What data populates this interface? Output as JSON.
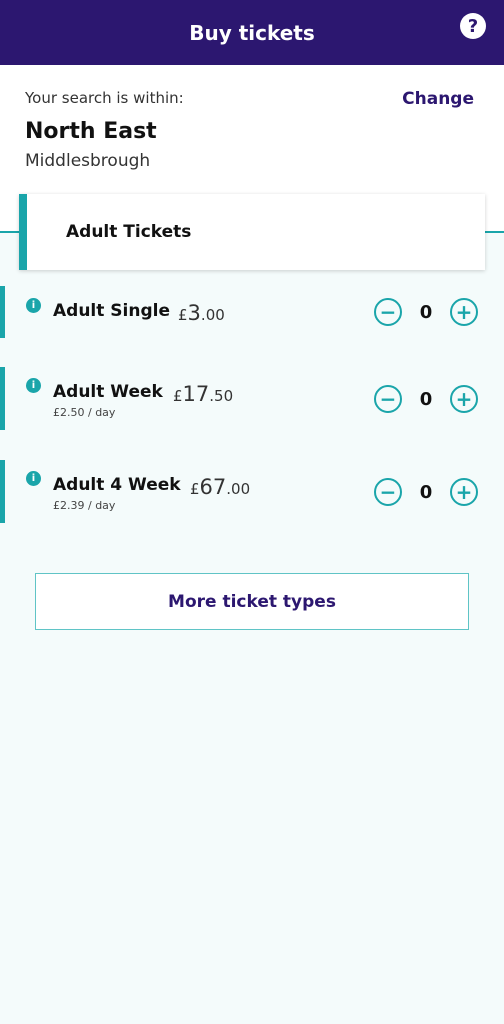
{
  "header": {
    "title": "Buy tickets",
    "help_icon_glyph": "?"
  },
  "search": {
    "label": "Your search is within:",
    "change_label": "Change",
    "region": "North East",
    "area": "Middlesbrough"
  },
  "section": {
    "title": "Adult Tickets"
  },
  "tickets": [
    {
      "name": "Adult Single",
      "price_symbol": "£",
      "price_major": "3",
      "price_minor": ".00",
      "per_day": "",
      "quantity": "0"
    },
    {
      "name": "Adult Week",
      "price_symbol": "£",
      "price_major": "17",
      "price_minor": ".50",
      "per_day": "£2.50 / day",
      "quantity": "0"
    },
    {
      "name": "Adult 4 Week",
      "price_symbol": "£",
      "price_major": "67",
      "price_minor": ".00",
      "per_day": "£2.39 / day",
      "quantity": "0"
    }
  ],
  "icons": {
    "info": "i",
    "minus": "−",
    "plus": "+"
  },
  "more_button": {
    "label": "More ticket types"
  },
  "colors": {
    "brand_purple": "#2c1770",
    "accent_teal": "#1aa5aa",
    "background": "#f4fbfb"
  }
}
